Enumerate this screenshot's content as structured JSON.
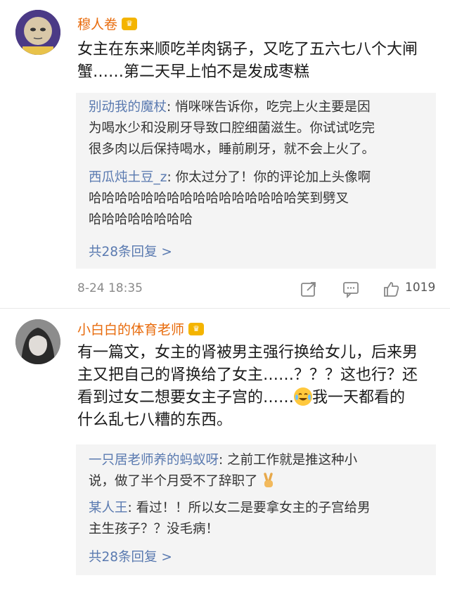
{
  "comments": [
    {
      "username": "穆人卷",
      "text_lines": [
        "女主在东来顺吃羊肉锅子，又吃了五六七八个大闸",
        "蟹……第二天早上怕不是发成枣糕"
      ],
      "replies": [
        {
          "name": "别动我的魔杖",
          "lines": [
            ": 悄咪咪告诉你，吃完上火主要是因",
            "为喝水少和没刷牙导致口腔细菌滋生。你试试吃完",
            "很多肉以后保持喝水，睡前刷牙，就不会上火了。"
          ]
        },
        {
          "name": "西瓜炖土豆_z",
          "lines": [
            ": 你太过分了！你的评论加上头像啊",
            "哈哈哈哈哈哈哈哈哈哈哈哈哈哈哈哈笑到劈叉",
            "哈哈哈哈哈哈哈哈"
          ]
        }
      ],
      "more_replies": "共28条回复 >",
      "timestamp": "8-24 18:35",
      "likes": "1019"
    },
    {
      "username": "小白白的体育老师",
      "text_lines": [
        "有一篇文，女主的肾被男主强行换给女儿，后来男",
        "主又把自己的肾换给了女主……？？？这也行？还",
        "看到过女二想要女主子宫的……",
        "我一天都看的",
        "什么乱七八糟的东西。"
      ],
      "replies": [
        {
          "name": "一只居老师养的蚂蚁呀",
          "lines": [
            ": 之前工作就是推这种小",
            "说，做了半个月受不了辞职了"
          ]
        },
        {
          "name": "某人王",
          "lines": [
            ": 看过！！所以女二是要拿女主的子宫给男",
            "主生孩子？？没毛病！"
          ]
        }
      ],
      "more_replies": "共28条回复 >"
    }
  ],
  "colors": {
    "username": "#e86b0c",
    "reply_name": "#5a7ab0",
    "reply_bg": "#f4f4f4",
    "meta": "#8a8a8a"
  },
  "icons": [
    "crown-badge-icon",
    "share-icon",
    "comment-icon",
    "like-icon",
    "laughing-crying-emoji",
    "victory-hand-emoji"
  ]
}
